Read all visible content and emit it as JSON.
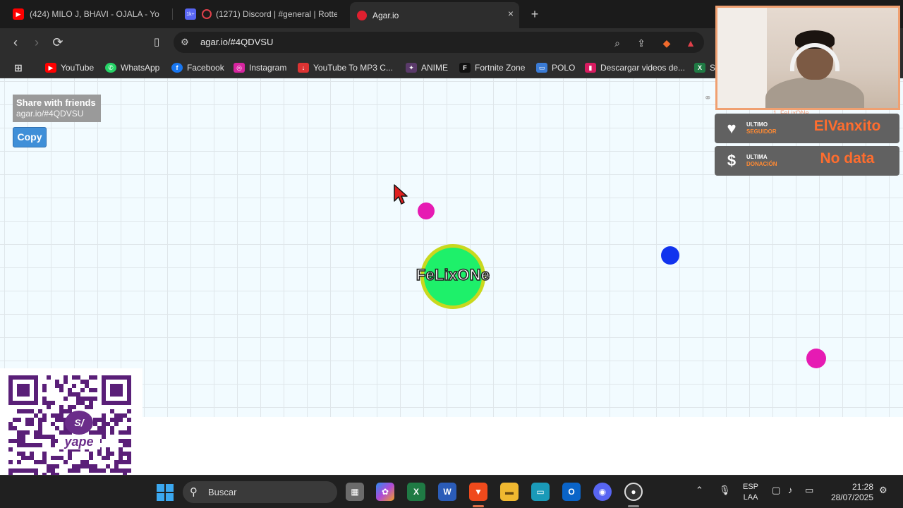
{
  "browser": {
    "tabs": [
      {
        "title": "(424) MILO J, BHAVI - OJALA - YouTube",
        "favicon": "youtube-icon",
        "active": false
      },
      {
        "title": "(1271) Discord | #general | Rotterdam",
        "favicon": "discord-icon",
        "badge": "1k+",
        "active": false
      },
      {
        "title": "Agar.io",
        "favicon": "agar-icon",
        "active": true
      }
    ],
    "new_tab": "+",
    "close_tab": "×",
    "url": "agar.io/#4QDVSU",
    "bookmarks": [
      {
        "label": "YouTube",
        "icon": "youtube-icon",
        "color": "#ff0000"
      },
      {
        "label": "WhatsApp",
        "icon": "whatsapp-icon",
        "color": "#25d366"
      },
      {
        "label": "Facebook",
        "icon": "facebook-icon",
        "color": "#1877f2"
      },
      {
        "label": "Instagram",
        "icon": "instagram-icon",
        "color": "#d6249f"
      },
      {
        "label": "YouTube To MP3 C...",
        "icon": "download-icon",
        "color": "#d33"
      },
      {
        "label": "ANIME",
        "icon": "anime-icon",
        "color": "#5a3a6a"
      },
      {
        "label": "Fortnite Zone",
        "icon": "fortnite-icon",
        "color": "#111111"
      },
      {
        "label": "POLO",
        "icon": "polo-icon",
        "color": "#3a7bd5"
      },
      {
        "label": "Descargar videos de...",
        "icon": "video-icon",
        "color": "#d81b60"
      },
      {
        "label": "S",
        "icon": "excel-icon",
        "color": "#1f7a44"
      }
    ]
  },
  "game": {
    "share_title": "Share with friends",
    "share_url": "agar.io/#4QDVSU",
    "copy_label": "Copy",
    "player_name": "FeLixONe",
    "player_color": "#1ef06a",
    "pellets": [
      {
        "color": "#e61bb3"
      },
      {
        "color": "#1133ee"
      },
      {
        "color": "#e61bb3"
      }
    ]
  },
  "stream": {
    "webcam_label": "1. FeLixONe",
    "follower_label_1": "ULTIMO",
    "follower_label_2": "SEGUIDOR",
    "follower_value": "ElVanxito",
    "donation_label_1": "ULTIMA",
    "donation_label_2": "DONACIÓN",
    "donation_value": "No data",
    "qr_brand": "yape",
    "qr_symbol": "S/"
  },
  "taskbar": {
    "search_placeholder": "Buscar",
    "lang_1": "ESP",
    "lang_2": "LAA",
    "time": "21:28",
    "date": "28/07/2025"
  }
}
